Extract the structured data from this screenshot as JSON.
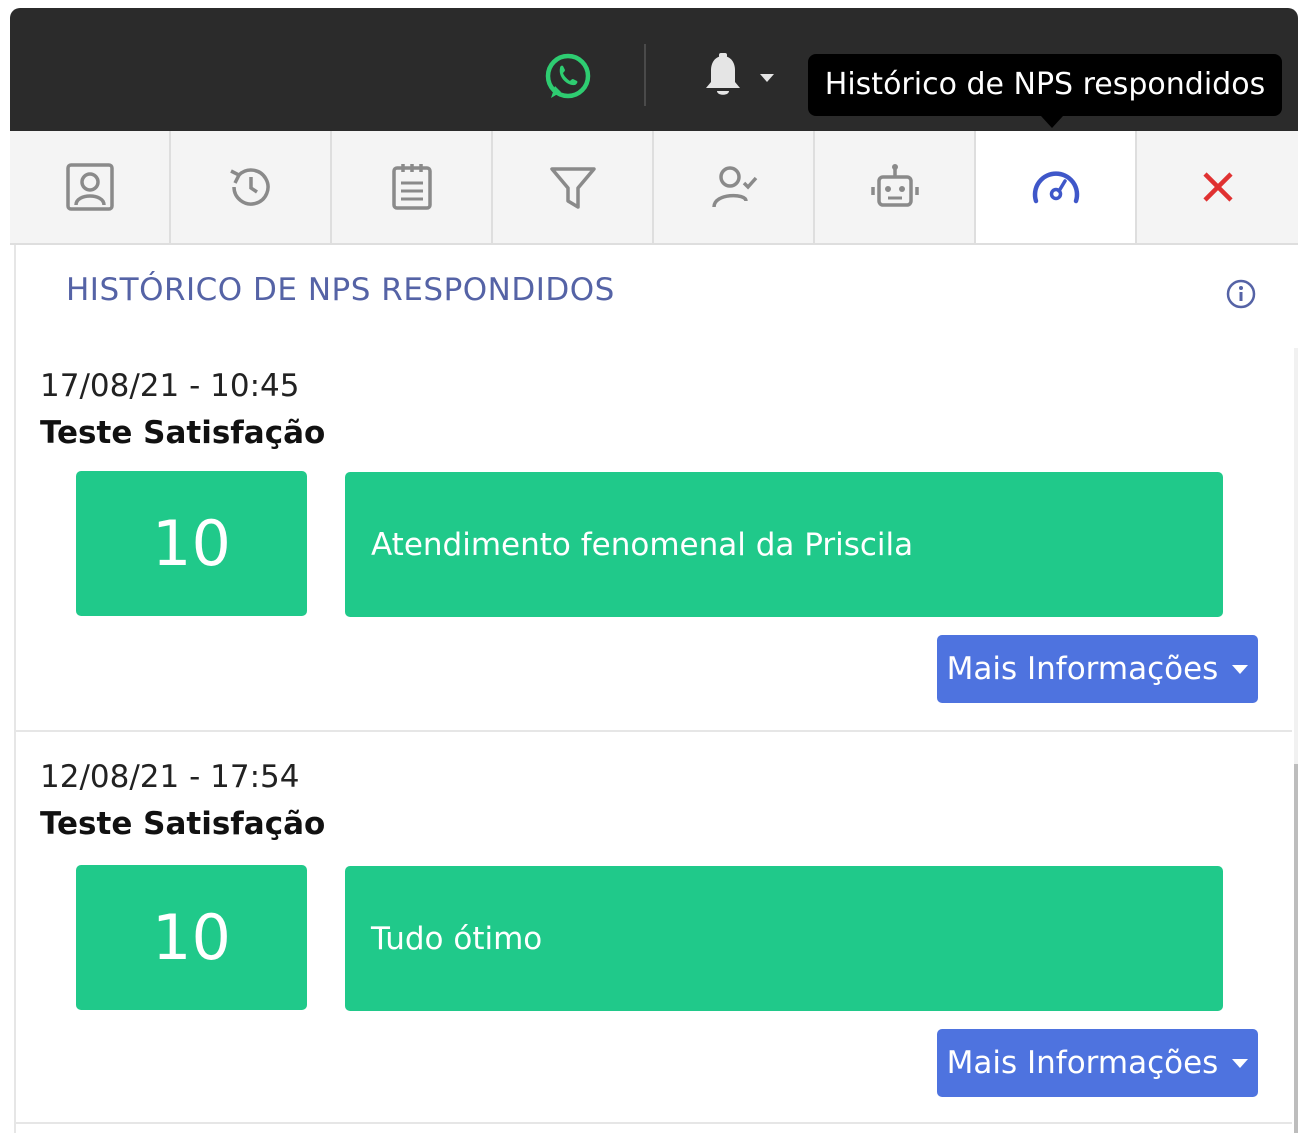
{
  "topbar": {
    "tooltip": "Histórico de NPS respondidos",
    "icons": [
      "whatsapp-icon",
      "bell-icon"
    ]
  },
  "tabs": [
    {
      "icon": "contact-card-icon"
    },
    {
      "icon": "history-icon"
    },
    {
      "icon": "notes-icon"
    },
    {
      "icon": "filter-icon"
    },
    {
      "icon": "user-check-icon"
    },
    {
      "icon": "robot-icon"
    },
    {
      "icon": "gauge-icon",
      "active": true
    },
    {
      "icon": "close-icon"
    }
  ],
  "panel": {
    "title": "HISTÓRICO DE NPS RESPONDIDOS"
  },
  "entries": [
    {
      "date": "17/08/21 - 10:45",
      "survey": "Teste Satisfação",
      "score": "10",
      "comment": "Atendimento fenomenal da Priscila",
      "button": "Mais Informações"
    },
    {
      "date": "12/08/21 - 17:54",
      "survey": "Teste Satisfação",
      "score": "10",
      "comment": "Tudo ótimo",
      "button": "Mais Informações"
    }
  ],
  "colors": {
    "topbar": "#2b2b2b",
    "score_green": "#20c98a",
    "button_blue": "#4e73df",
    "title_blue": "#5563a6",
    "close_red": "#e03131",
    "active_tab_icon": "#3f57c9",
    "whatsapp_green": "#2ecc71"
  }
}
